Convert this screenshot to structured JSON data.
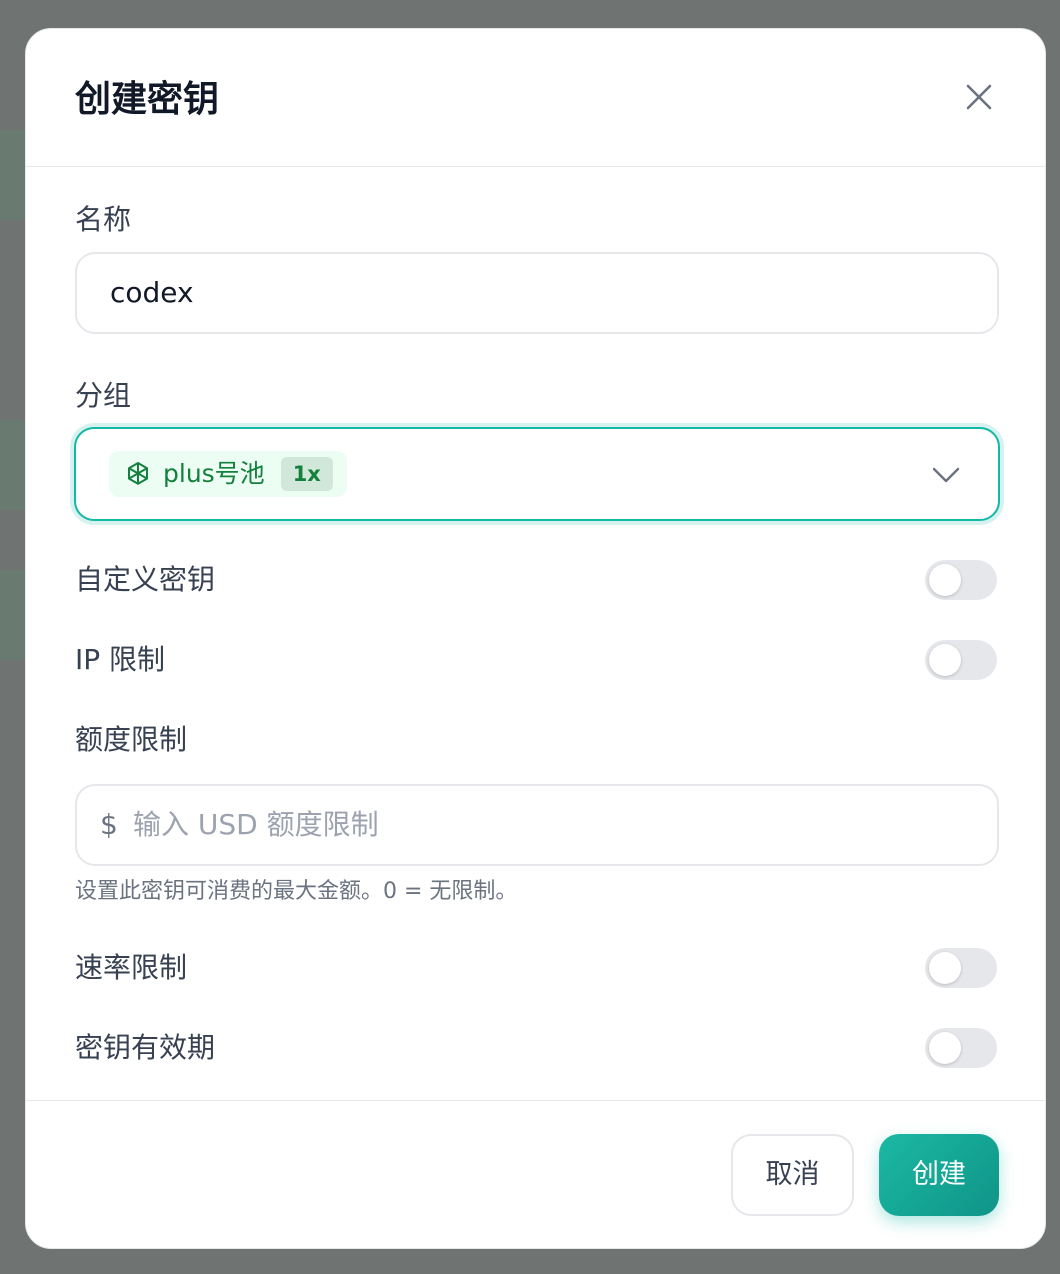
{
  "dialog": {
    "title": "创建密钥"
  },
  "form": {
    "name": {
      "label": "名称",
      "value": "codex"
    },
    "group": {
      "label": "分组",
      "selected": {
        "name": "plus号池",
        "badge": "1x",
        "icon": "openai-icon"
      }
    },
    "custom_key": {
      "label": "自定义密钥",
      "enabled": false
    },
    "ip_limit": {
      "label": "IP 限制",
      "enabled": false
    },
    "quota": {
      "label": "额度限制",
      "currency_symbol": "$",
      "placeholder": "输入 USD 额度限制",
      "help": "设置此密钥可消费的最大金额。0 = 无限制。"
    },
    "rate_limit": {
      "label": "速率限制",
      "enabled": false
    },
    "expiry": {
      "label": "密钥有效期",
      "enabled": false
    }
  },
  "footer": {
    "cancel_label": "取消",
    "create_label": "创建"
  },
  "colors": {
    "accent": "#14b8a6",
    "chip_text": "#15803d",
    "chip_bg": "#ecfdf3"
  }
}
